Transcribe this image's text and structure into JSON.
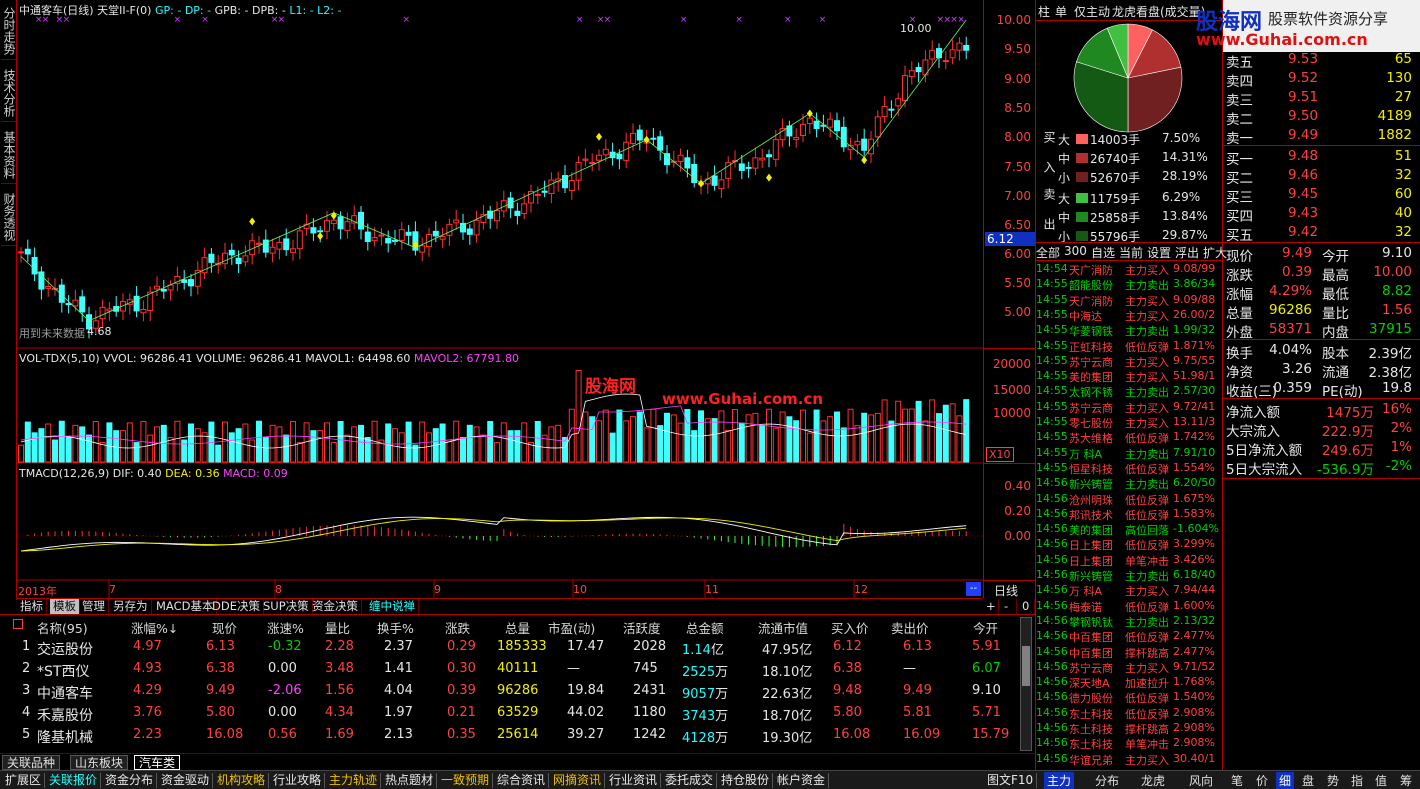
{
  "left_tabs": [
    "分时走势",
    "技术分析",
    "基本资料",
    "财务透视"
  ],
  "chart": {
    "header": {
      "title": "中通客车(日线)",
      "indicator": "天堂II-F(0)",
      "gp": "GP: -",
      "dp": "DP: -",
      "gpb": "GPB: -",
      "dpb": "DPB: -",
      "l1": "L1: -",
      "l2": "L2: -"
    },
    "hi_label": "10.00",
    "lo_label": "4.68",
    "future_label": "用到未来数据",
    "price_ticks": [
      "10.00",
      "9.50",
      "9.00",
      "8.50",
      "8.00",
      "7.50",
      "7.00",
      "6.50",
      "6.00",
      "5.50",
      "5.00"
    ],
    "current_price_box": "6.12",
    "vol_header": {
      "name": "VOL-TDX(5,10)",
      "vvol": "VVOL: 96286.41",
      "volume": "VOLUME: 96286.41",
      "mavol1": "MAVOL1: 64498.60",
      "mavol2": "MAVOL2: 67791.80"
    },
    "vol_ticks": [
      "20000",
      "15000",
      "10000"
    ],
    "vol_unit": "X10",
    "macd_header": {
      "name": "TMACD(12,26,9)",
      "dif": "DIF: 0.40",
      "dea": "DEA: 0.36",
      "macd": "MACD: 0.09"
    },
    "macd_ticks": [
      "0.40",
      "0.20",
      "0.00"
    ],
    "date_labels": [
      "2013年",
      "7",
      "8",
      "9",
      "10",
      "11",
      "12"
    ],
    "period": "日线",
    "watermark_logo": "股海网",
    "watermark_url": "www.Guhai.com.cn"
  },
  "chart_tabs": [
    "指标",
    "模板",
    "管理",
    "另存为",
    "MACD基本",
    "DDE决策",
    "SUP决策",
    "资金决策",
    "缠中说禅"
  ],
  "chart_tab_controls": [
    "+",
    "-",
    "0"
  ],
  "table": {
    "headers": [
      "名称(95)",
      "涨幅%↓",
      "现价",
      "涨速%",
      "量比",
      "换手%",
      "涨跌",
      "总量",
      "市盈(动)",
      "活跃度",
      "总金额",
      "流通市值",
      "买入价",
      "卖出价",
      "今开"
    ],
    "rows": [
      {
        "idx": "1",
        "name": "交运股份",
        "chg_pct": "4.97",
        "price": "6.13",
        "speed": "-0.32",
        "vol_ratio": "2.28",
        "turnover": "2.37",
        "chg": "0.29",
        "volume": "185333",
        "pe": "17.47",
        "activity": "2028",
        "amount": "1.14",
        "amount_unit": "亿",
        "float_cap": "47.95亿",
        "bid": "6.12",
        "ask": "6.13",
        "open": "5.91"
      },
      {
        "idx": "2",
        "name": "*ST西仪",
        "chg_pct": "4.93",
        "price": "6.38",
        "speed": "0.00",
        "vol_ratio": "3.48",
        "turnover": "1.41",
        "chg": "0.30",
        "volume": "40111",
        "pe": "—",
        "activity": "745",
        "amount": "2525",
        "amount_unit": "万",
        "float_cap": "18.10亿",
        "bid": "6.38",
        "ask": "—",
        "open": "6.07"
      },
      {
        "idx": "3",
        "name": "中通客车",
        "chg_pct": "4.29",
        "price": "9.49",
        "speed": "-2.06",
        "vol_ratio": "1.56",
        "turnover": "4.04",
        "chg": "0.39",
        "volume": "96286",
        "pe": "19.84",
        "activity": "2431",
        "amount": "9057",
        "amount_unit": "万",
        "float_cap": "22.63亿",
        "bid": "9.48",
        "ask": "9.49",
        "open": "9.10"
      },
      {
        "idx": "4",
        "name": "禾嘉股份",
        "chg_pct": "3.76",
        "price": "5.80",
        "speed": "0.00",
        "vol_ratio": "4.34",
        "turnover": "1.97",
        "chg": "0.21",
        "volume": "63529",
        "pe": "44.02",
        "activity": "1180",
        "amount": "3743",
        "amount_unit": "万",
        "float_cap": "18.70亿",
        "bid": "5.80",
        "ask": "5.81",
        "open": "5.71"
      },
      {
        "idx": "5",
        "name": "隆基机械",
        "chg_pct": "2.23",
        "price": "16.08",
        "speed": "0.56",
        "vol_ratio": "1.69",
        "turnover": "2.13",
        "chg": "0.35",
        "volume": "25614",
        "pe": "39.27",
        "activity": "1242",
        "amount": "4128",
        "amount_unit": "万",
        "float_cap": "19.30亿",
        "bid": "16.08",
        "ask": "16.09",
        "open": "15.79"
      }
    ]
  },
  "sector_tabs": [
    "关联品种",
    "山东板块",
    "汽车类"
  ],
  "bottom_tabs": [
    "扩展区",
    "关联报价",
    "资金分布",
    "资金驱动",
    "机构攻略",
    "行业攻略",
    "主力轨迹",
    "热点题材",
    "一致预期",
    "综合资讯",
    "网摘资讯",
    "行业资讯",
    "委托成交",
    "持仓股份",
    "帐户资金"
  ],
  "bottom_right": "图文F10",
  "right": {
    "top_tabs": [
      "柱",
      "单",
      "仅主动",
      "龙虎看盘(成交量)"
    ],
    "logo_cn": "股海网",
    "logo_slogan": "股票软件资源分享",
    "logo_url": "www.Guhai.com.cn",
    "pie": {
      "slices_pct": [
        7.5,
        14.31,
        28.19,
        6.29,
        13.84,
        29.87
      ]
    },
    "flow_buy_label": "买入",
    "flow_sell_label": "卖出",
    "flow": [
      {
        "size": "大",
        "vol": "14003手",
        "pct": "7.50%",
        "color": "#ff6060"
      },
      {
        "size": "中",
        "vol": "26740手",
        "pct": "14.31%",
        "color": "#b03030"
      },
      {
        "size": "小",
        "vol": "52670手",
        "pct": "28.19%",
        "color": "#702020"
      },
      {
        "size": "大",
        "vol": "11759手",
        "pct": "6.29%",
        "color": "#40c040"
      },
      {
        "size": "中",
        "vol": "25858手",
        "pct": "13.84%",
        "color": "#208820"
      },
      {
        "size": "小",
        "vol": "55796手",
        "pct": "29.87%",
        "color": "#145a14"
      }
    ],
    "filter_tabs": [
      "全部",
      "300",
      "自选",
      "当前",
      "设置",
      "浮出",
      "扩大"
    ],
    "trades": [
      {
        "t": "14:54",
        "name": "天广消防",
        "type": "主力买入",
        "val": "9.08/99",
        "nc": "red",
        "tc": "red"
      },
      {
        "t": "14:55",
        "name": "韶能股份",
        "type": "主力卖出",
        "val": "3.86/34",
        "nc": "green",
        "tc": "green"
      },
      {
        "t": "14:55",
        "name": "天广消防",
        "type": "主力买入",
        "val": "9.09/88",
        "nc": "red",
        "tc": "red"
      },
      {
        "t": "14:55",
        "name": "中海达",
        "type": "主力买入",
        "val": "26.00/2",
        "nc": "red",
        "tc": "red"
      },
      {
        "t": "14:55",
        "name": "华菱钢铁",
        "type": "主力卖出",
        "val": "1.99/32",
        "nc": "green",
        "tc": "green"
      },
      {
        "t": "14:55",
        "name": "正虹科技",
        "type": "低位反弹",
        "val": "1.871%",
        "nc": "red",
        "tc": "red"
      },
      {
        "t": "14:55",
        "name": "苏宁云商",
        "type": "主力买入",
        "val": "9.75/55",
        "nc": "red",
        "tc": "red"
      },
      {
        "t": "14:55",
        "name": "美的集团",
        "type": "主力买入",
        "val": "51.98/1",
        "nc": "red",
        "tc": "red"
      },
      {
        "t": "14:55",
        "name": "太钢不锈",
        "type": "主力卖出",
        "val": "2.57/30",
        "nc": "green",
        "tc": "green"
      },
      {
        "t": "14:55",
        "name": "苏宁云商",
        "type": "主力买入",
        "val": "9.72/41",
        "nc": "red",
        "tc": "red"
      },
      {
        "t": "14:55",
        "name": "零七股份",
        "type": "主力买入",
        "val": "13.11/3",
        "nc": "red",
        "tc": "red"
      },
      {
        "t": "14:55",
        "name": "苏大维格",
        "type": "低位反弹",
        "val": "1.742%",
        "nc": "red",
        "tc": "red"
      },
      {
        "t": "14:55",
        "name": "万  科A",
        "type": "主力卖出",
        "val": "7.91/10",
        "nc": "green",
        "tc": "green"
      },
      {
        "t": "14:55",
        "name": "恒星科技",
        "type": "低位反弹",
        "val": "1.554%",
        "nc": "red",
        "tc": "red"
      },
      {
        "t": "14:56",
        "name": "新兴铸管",
        "type": "主力卖出",
        "val": "6.20/50",
        "nc": "green",
        "tc": "green"
      },
      {
        "t": "14:56",
        "name": "沧州明珠",
        "type": "低位反弹",
        "val": "1.675%",
        "nc": "red",
        "tc": "red"
      },
      {
        "t": "14:56",
        "name": "邦讯技术",
        "type": "低位反弹",
        "val": "1.583%",
        "nc": "red",
        "tc": "red"
      },
      {
        "t": "14:56",
        "name": "美的集团",
        "type": "高位回落",
        "val": "-1.604%",
        "nc": "green",
        "tc": "green"
      },
      {
        "t": "14:56",
        "name": "日上集团",
        "type": "低位反弹",
        "val": "3.299%",
        "nc": "red",
        "tc": "red"
      },
      {
        "t": "14:56",
        "name": "日上集团",
        "type": "单笔冲击",
        "val": "3.426%",
        "nc": "red",
        "tc": "red"
      },
      {
        "t": "14:56",
        "name": "新兴铸管",
        "type": "主力卖出",
        "val": "6.18/40",
        "nc": "green",
        "tc": "green"
      },
      {
        "t": "14:56",
        "name": "万  科A",
        "type": "主力买入",
        "val": "7.94/44",
        "nc": "red",
        "tc": "red"
      },
      {
        "t": "14:56",
        "name": "梅泰诺",
        "type": "低位反弹",
        "val": "1.600%",
        "nc": "red",
        "tc": "red"
      },
      {
        "t": "14:56",
        "name": "攀钢钒钛",
        "type": "主力卖出",
        "val": "2.13/32",
        "nc": "green",
        "tc": "green"
      },
      {
        "t": "14:56",
        "name": "中百集团",
        "type": "低位反弹",
        "val": "2.477%",
        "nc": "red",
        "tc": "red"
      },
      {
        "t": "14:56",
        "name": "中百集团",
        "type": "撑杆跳高",
        "val": "2.477%",
        "nc": "red",
        "tc": "red"
      },
      {
        "t": "14:56",
        "name": "苏宁云商",
        "type": "主力买入",
        "val": "9.71/52",
        "nc": "red",
        "tc": "red"
      },
      {
        "t": "14:56",
        "name": "深天地A",
        "type": "加速拉升",
        "val": "1.768%",
        "nc": "red",
        "tc": "red"
      },
      {
        "t": "14:56",
        "name": "德力股份",
        "type": "低位反弹",
        "val": "1.540%",
        "nc": "red",
        "tc": "red"
      },
      {
        "t": "14:56",
        "name": "东土科技",
        "type": "低位反弹",
        "val": "2.908%",
        "nc": "red",
        "tc": "red"
      },
      {
        "t": "14:56",
        "name": "东土科技",
        "type": "撑杆跳高",
        "val": "2.908%",
        "nc": "red",
        "tc": "red"
      },
      {
        "t": "14:56",
        "name": "东土科技",
        "type": "单笔冲击",
        "val": "2.908%",
        "nc": "red",
        "tc": "red"
      },
      {
        "t": "14:56",
        "name": "华谊兄弟",
        "type": "主力买入",
        "val": "30.40/1",
        "nc": "red",
        "tc": "red"
      }
    ],
    "asks": [
      {
        "label": "卖五",
        "price": "9.53",
        "vol": "65"
      },
      {
        "label": "卖四",
        "price": "9.52",
        "vol": "130"
      },
      {
        "label": "卖三",
        "price": "9.51",
        "vol": "27"
      },
      {
        "label": "卖二",
        "price": "9.50",
        "vol": "4189"
      },
      {
        "label": "卖一",
        "price": "9.49",
        "vol": "1882"
      }
    ],
    "bids": [
      {
        "label": "买一",
        "price": "9.48",
        "vol": "51"
      },
      {
        "label": "买二",
        "price": "9.46",
        "vol": "32"
      },
      {
        "label": "买三",
        "price": "9.45",
        "vol": "60"
      },
      {
        "label": "买四",
        "price": "9.43",
        "vol": "40"
      },
      {
        "label": "买五",
        "price": "9.42",
        "vol": "32"
      }
    ],
    "stats": [
      {
        "l1": "现价",
        "v1": "9.49",
        "c1": "red",
        "l2": "今开",
        "v2": "9.10",
        "c2": "white"
      },
      {
        "l1": "涨跌",
        "v1": "0.39",
        "c1": "red",
        "l2": "最高",
        "v2": "10.00",
        "c2": "red"
      },
      {
        "l1": "涨幅",
        "v1": "4.29%",
        "c1": "red",
        "l2": "最低",
        "v2": "8.82",
        "c2": "green"
      },
      {
        "l1": "总量",
        "v1": "96286",
        "c1": "yellow",
        "l2": "量比",
        "v2": "1.56",
        "c2": "red"
      },
      {
        "l1": "外盘",
        "v1": "58371",
        "c1": "red",
        "l2": "内盘",
        "v2": "37915",
        "c2": "green"
      }
    ],
    "stats2": [
      {
        "l1": "换手",
        "v1": "4.04%",
        "l2": "股本",
        "v2": "2.39亿"
      },
      {
        "l1": "净资",
        "v1": "3.26",
        "l2": "流通",
        "v2": "2.38亿"
      },
      {
        "l1": "收益(三)",
        "v1": "0.359",
        "l2": "PE(动)",
        "v2": "19.8"
      }
    ],
    "funds": [
      {
        "label": "净流入额",
        "val": "1475万",
        "pct": "16%",
        "c": "red"
      },
      {
        "label": "大宗流入",
        "val": "222.9万",
        "pct": "2%",
        "c": "red"
      },
      {
        "label": "5日净流入额",
        "val": "249.6万",
        "pct": "1%",
        "c": "red"
      },
      {
        "label": "5日大宗流入",
        "val": "-536.9万",
        "pct": "-2%",
        "c": "green"
      }
    ],
    "bottom_tabs": [
      "主力",
      "分布",
      "龙虎",
      "风向",
      "笔",
      "价",
      "细",
      "盘",
      "势",
      "指",
      "值",
      "筹"
    ]
  }
}
